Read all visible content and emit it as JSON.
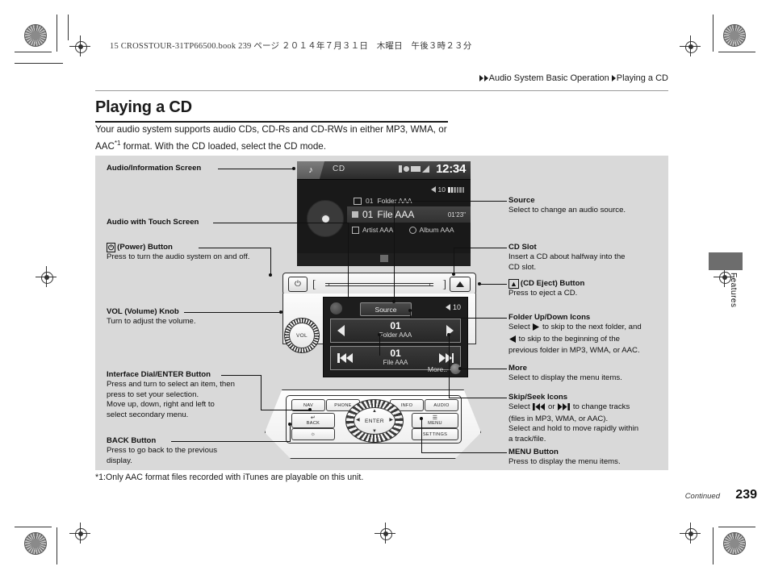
{
  "header": {
    "book_line": "15 CROSSTOUR-31TP66500.book   239 ページ   ２０１４年７月３１日　木曜日　午後３時２３分",
    "breadcrumb_section": "Audio System Basic Operation",
    "breadcrumb_page": "Playing a CD"
  },
  "title": "Playing a CD",
  "intro": {
    "line_before": "Your audio system supports audio CDs, CD-Rs and CD-RWs in either MP3, WMA, or AAC",
    "sup": "*1",
    "line_after": " format. With the CD loaded, select the CD mode."
  },
  "labels_left": [
    {
      "id": "audio-information-screen",
      "heading": "Audio/Information Screen",
      "body": []
    },
    {
      "id": "audio-with-touch-screen",
      "heading": "Audio with Touch Screen",
      "body": []
    },
    {
      "id": "power-button",
      "icon": "power-icon",
      "heading": "(Power) Button",
      "body": [
        "Press to turn the audio system on and off."
      ]
    },
    {
      "id": "vol-volume-knob",
      "heading": "VOL (Volume) Knob",
      "body": [
        "Turn to adjust the volume."
      ]
    },
    {
      "id": "interface-dial-enter-button",
      "heading": "Interface Dial/ENTER Button",
      "body": [
        "Press and turn to select an item, then",
        "press to set your selection.",
        "Move up, down, right and left to",
        "select secondary menu."
      ]
    },
    {
      "id": "back-button",
      "heading": "BACK Button",
      "body": [
        "Press to go back to the previous",
        "display."
      ]
    }
  ],
  "labels_right": [
    {
      "id": "source",
      "heading": "Source",
      "body": [
        "Select to change an audio source."
      ]
    },
    {
      "id": "cd-slot",
      "heading": "CD Slot",
      "body": [
        "Insert a CD about halfway into the",
        "CD slot."
      ]
    },
    {
      "id": "cd-eject-button",
      "icon": "eject-icon",
      "heading": "(CD Eject) Button",
      "body": [
        "Press to eject a CD."
      ]
    },
    {
      "id": "folder-up-down-icons",
      "heading": "Folder Up/Down Icons",
      "body": []
    },
    {
      "id": "more",
      "heading": "More",
      "body": [
        "Select to display the menu items."
      ]
    },
    {
      "id": "skip-seek-icons",
      "heading": "Skip/Seek Icons",
      "body": []
    },
    {
      "id": "menu-button",
      "heading": "MENU Button",
      "body": [
        "Press to display the menu items."
      ]
    }
  ],
  "folder_text": {
    "p1": "Select ",
    "p2": " to skip to the next folder, and",
    "p3": " to skip to the beginning of the",
    "p4": "previous folder in MP3, WMA, or AAC."
  },
  "skip_text": {
    "p1": "Select ",
    "p2": " or ",
    "p3": " to change tracks",
    "p4": "(files in MP3, WMA, or AAC).",
    "p5": "Select and hold to move rapidly within",
    "p6": "a track/file."
  },
  "screen": {
    "source_label": "CD",
    "clock": "12:34",
    "volume": "10",
    "folder_number": "01",
    "folder_name": "Folder AAA",
    "file_number": "01",
    "file_name": "File AAA",
    "duration": "01'23\"",
    "artist": "Artist AAA",
    "album": "Album AAA"
  },
  "touch_panel": {
    "source_button": "Source",
    "volume": "10",
    "folder_number": "01",
    "folder_name": "Folder AAA",
    "file_number": "01",
    "file_name": "File AAA",
    "more_label": "More.."
  },
  "console_buttons": {
    "nav": "NAV",
    "phone": "PHONE",
    "info": "INFO",
    "audio": "AUDIO",
    "back": "BACK",
    "enter": "ENTER",
    "menu": "MENU",
    "settings": "SETTINGS"
  },
  "footnote": "*1:Only AAC format files recorded with iTunes are playable on this unit.",
  "footer": {
    "continued": "Continued",
    "page_number": "239",
    "side_tab_label": "Features"
  }
}
